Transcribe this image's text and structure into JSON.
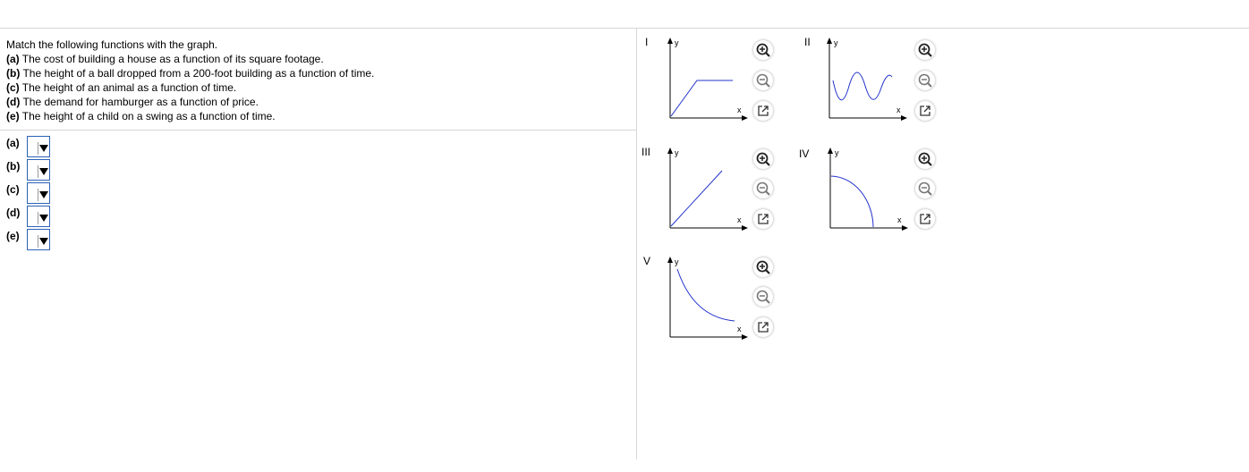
{
  "question": {
    "intro": "Match the following functions with the graph.",
    "items": [
      {
        "label": "(a)",
        "text": "The cost of building a house as a function of its square footage."
      },
      {
        "label": "(b)",
        "text": "The height of a ball dropped from a 200-foot building as a function of time."
      },
      {
        "label": "(c)",
        "text": "The height of an animal as a function of time."
      },
      {
        "label": "(d)",
        "text": "The demand for hamburger as a function of price."
      },
      {
        "label": "(e)",
        "text": "The height of a child on a swing as a function of time."
      }
    ]
  },
  "answers": [
    {
      "label": "(a)",
      "value": ""
    },
    {
      "label": "(b)",
      "value": ""
    },
    {
      "label": "(c)",
      "value": ""
    },
    {
      "label": "(d)",
      "value": ""
    },
    {
      "label": "(e)",
      "value": ""
    }
  ],
  "graphs": [
    {
      "numeral": "I",
      "shape": "ramp-then-flat"
    },
    {
      "numeral": "II",
      "shape": "wave"
    },
    {
      "numeral": "III",
      "shape": "straight-line"
    },
    {
      "numeral": "IV",
      "shape": "quarter-circle"
    },
    {
      "numeral": "V",
      "shape": "decay-curve"
    }
  ],
  "axis": {
    "x": "x",
    "y": "y"
  },
  "curve_color": "#2233cc",
  "icons": {
    "zoom_in": "zoom-in-icon",
    "zoom_out": "zoom-out-icon",
    "popout": "popout-icon"
  }
}
